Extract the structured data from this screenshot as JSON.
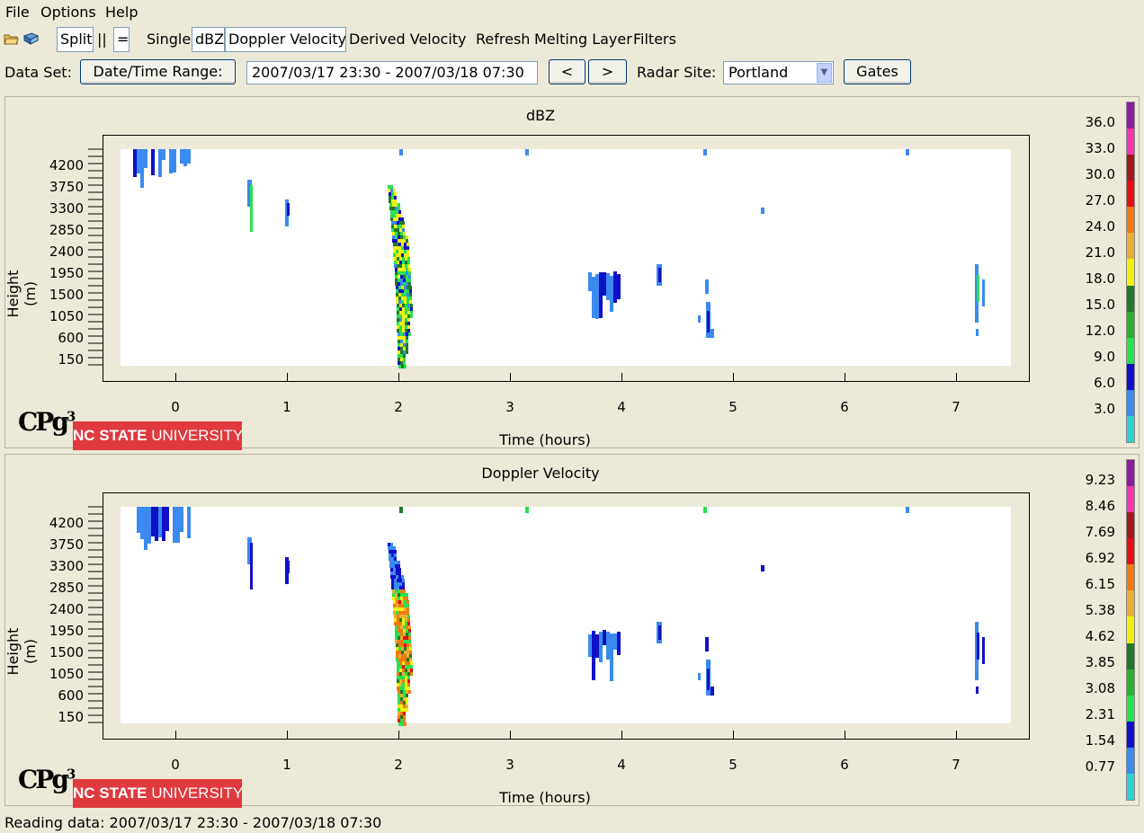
{
  "menu": {
    "file": "File",
    "options": "Options",
    "help": "Help"
  },
  "toolbar": {
    "split": "Split",
    "parallel": "||",
    "equals": "=",
    "single": "Single",
    "dbz": "dBZ",
    "doppler": "Doppler Velocity",
    "derived": "Derived Velocity",
    "refresh": "Refresh",
    "melting": "Melting Layer",
    "filters": "Filters",
    "icons": [
      "open-folder-icon",
      "book-icon"
    ]
  },
  "dataset": {
    "label": "Data Set:",
    "range_button": "Date/Time Range:",
    "range_value": "2007/03/17 23:30 - 2007/03/18 07:30",
    "prev": "<",
    "next": ">",
    "site_label": "Radar Site:",
    "site_value": "Portland",
    "gates": "Gates"
  },
  "panels": [
    {
      "title": "dBZ",
      "ylabel": "Height (m)",
      "xlabel": "Time (hours)",
      "yticks": [
        "4200",
        "3750",
        "3300",
        "2850",
        "2400",
        "1950",
        "1500",
        "1050",
        "600",
        "150"
      ],
      "xticks": [
        "0",
        "1",
        "2",
        "3",
        "4",
        "5",
        "6",
        "7"
      ],
      "legend_labels": [
        "36.0",
        "33.0",
        "30.0",
        "27.0",
        "24.0",
        "21.0",
        "18.0",
        "15.0",
        "12.0",
        "9.0",
        "6.0",
        "3.0"
      ]
    },
    {
      "title": "Doppler Velocity",
      "ylabel": "Height (m)",
      "xlabel": "Time (hours)",
      "yticks": [
        "4200",
        "3750",
        "3300",
        "2850",
        "2400",
        "1950",
        "1500",
        "1050",
        "600",
        "150"
      ],
      "xticks": [
        "0",
        "1",
        "2",
        "3",
        "4",
        "5",
        "6",
        "7"
      ],
      "legend_labels": [
        "9.23",
        "8.46",
        "7.69",
        "6.92",
        "6.15",
        "5.38",
        "4.62",
        "3.85",
        "3.08",
        "2.31",
        "1.54",
        "0.77"
      ]
    }
  ],
  "legend_colors": [
    "#8e1b9e",
    "#ef3aa8",
    "#a01a1a",
    "#e01010",
    "#f07a10",
    "#e8b030",
    "#f0f010",
    "#1f7a2a",
    "#2ab02a",
    "#2ae050",
    "#1010c8",
    "#3a8af0",
    "#30d0d0"
  ],
  "logos": {
    "cpg": "CPg",
    "cpg_sup": "3",
    "ncsu_bold": "NC STATE",
    "ncsu_rest": " UNIVERSITY"
  },
  "status": "Reading data: 2007/03/17 23:30 - 2007/03/18 07:30"
}
